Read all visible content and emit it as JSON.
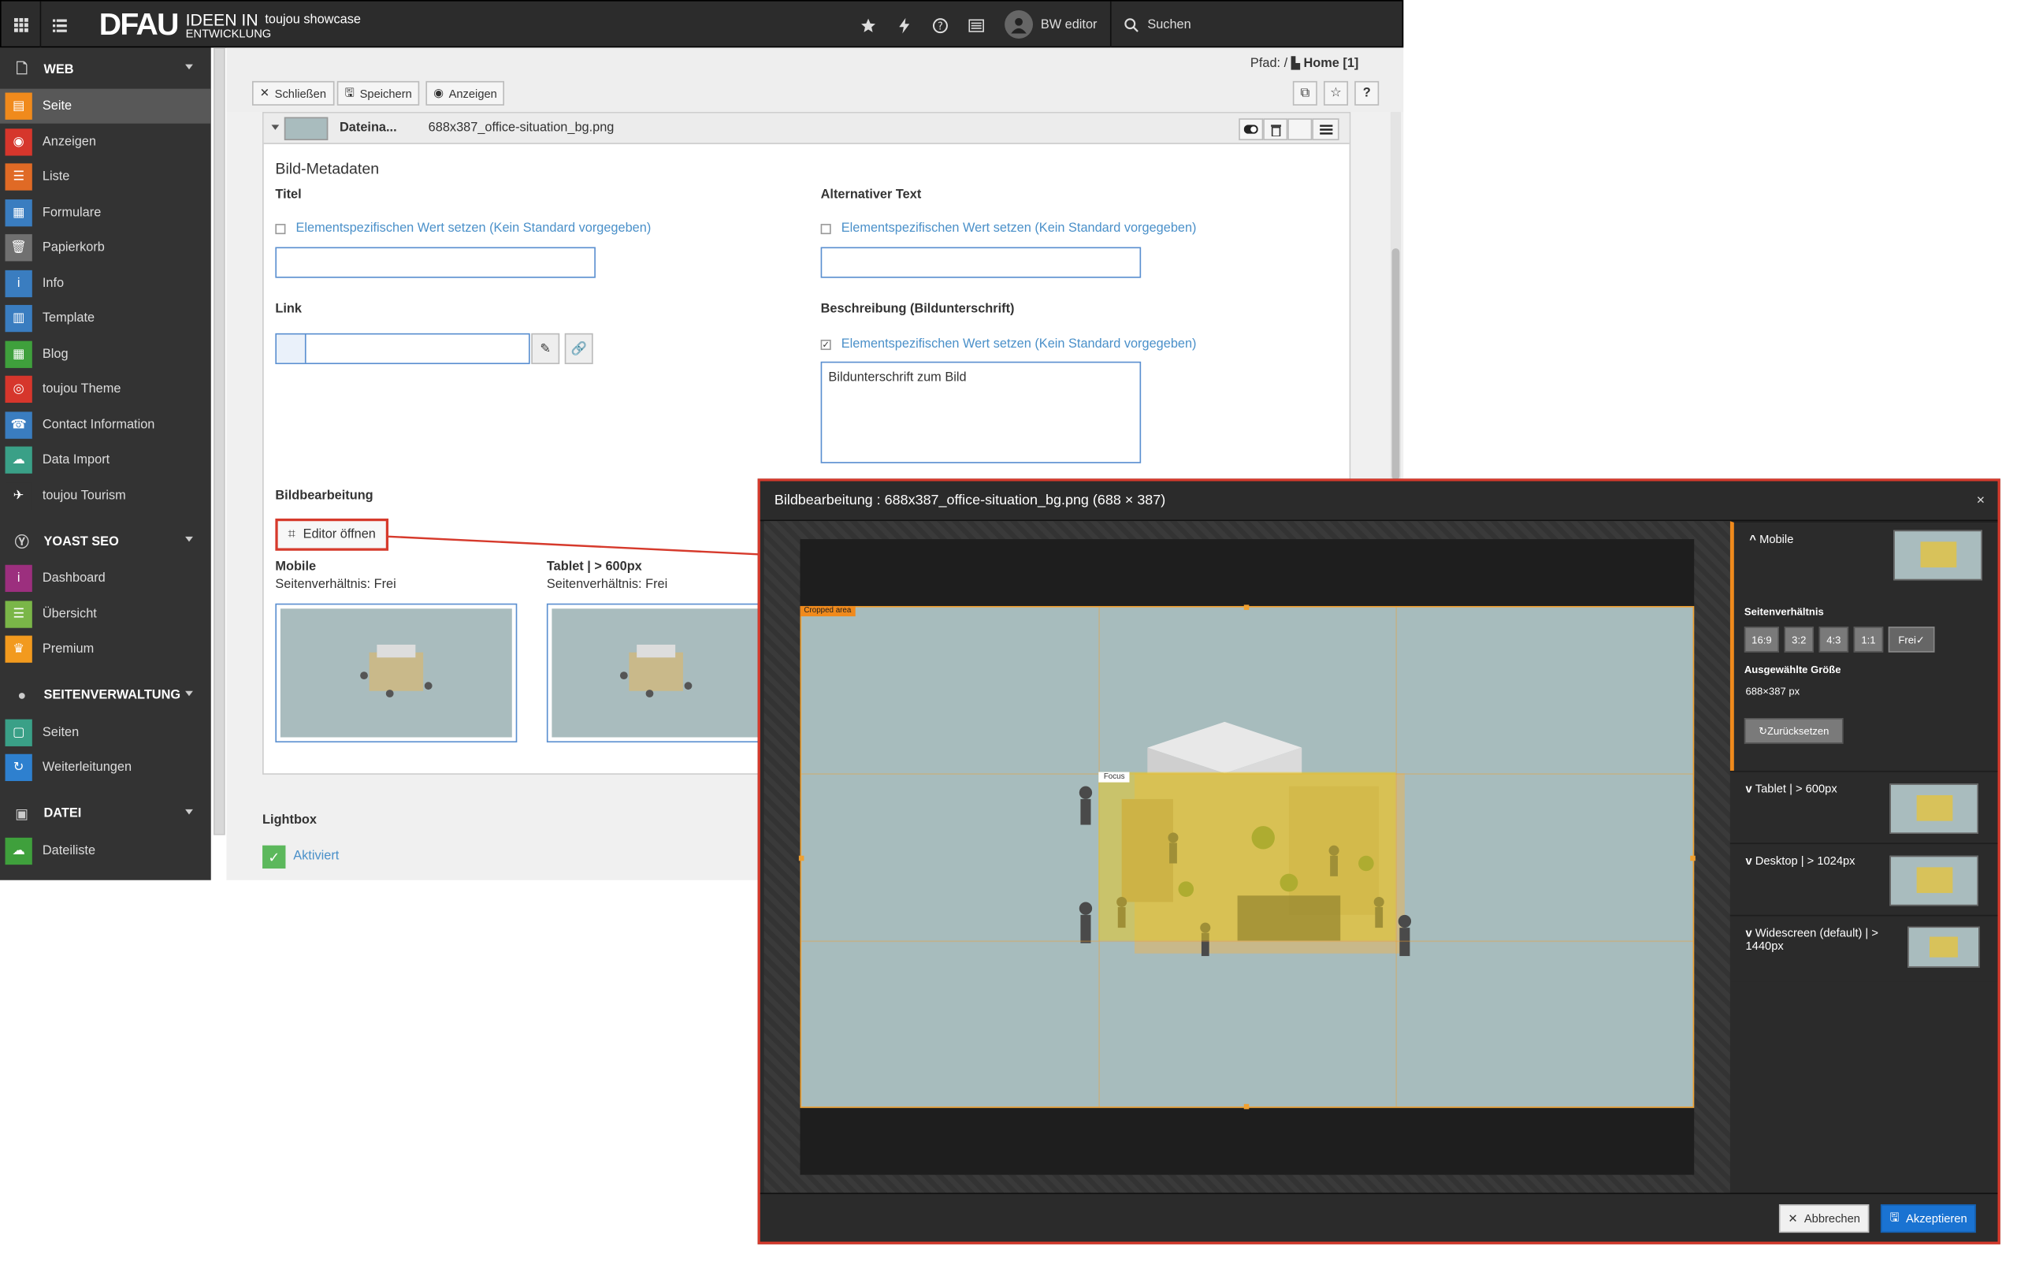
{
  "topbar": {
    "logo_text": "DFAU",
    "logo_sub_1": "IDEEN IN",
    "logo_sub_2": "ENTWICKLUNG",
    "site_name": "toujou showcase",
    "user_name": "BW editor",
    "search_label": "Suchen"
  },
  "sidebar": {
    "sections": [
      {
        "title": "WEB",
        "items": [
          "Seite",
          "Anzeigen",
          "Liste",
          "Formulare",
          "Papierkorb",
          "Info",
          "Template",
          "Blog",
          "toujou Theme",
          "Contact Information",
          "Data Import",
          "toujou Tourism"
        ]
      },
      {
        "title": "YOAST SEO",
        "items": [
          "Dashboard",
          "Übersicht",
          "Premium"
        ]
      },
      {
        "title": "SEITENVERWALTUNG",
        "items": [
          "Seiten",
          "Weiterleitungen"
        ]
      },
      {
        "title": "DATEI",
        "items": [
          "Dateiliste"
        ]
      }
    ],
    "item_colors": {
      "Seite": "#f08a1c",
      "Anzeigen": "#d6362c",
      "Liste": "#e06a25",
      "Formulare": "#3a7dc0",
      "Papierkorb": "#707070",
      "Info": "#3a7dc0",
      "Template": "#3a7dc0",
      "Blog": "#3fa03c",
      "toujou Theme": "#d6362c",
      "Contact Information": "#3a7dc0",
      "Data Import": "#3aa087",
      "toujou Tourism": "#333333",
      "Dashboard": "#9c2f7e",
      "Übersicht": "#7ab648",
      "Premium": "#f29a1e",
      "Seiten": "#3aa087",
      "Weiterleitungen": "#2e80cf",
      "Dateiliste": "#3fa03c"
    }
  },
  "docheader": {
    "close_label": "Schließen",
    "save_label": "Speichern",
    "view_label": "Anzeigen",
    "path_label": "Pfad: /",
    "path_page": "Home [1]",
    "help_label": "?"
  },
  "file_ref": {
    "header_label": "Dateina...",
    "filename": "688x387_office-situation_bg.png",
    "metadata_title": "Bild-Metadaten",
    "title_label": "Titel",
    "title_override": "Elementspezifischen Wert setzen (Kein Standard vorgegeben)",
    "alt_label": "Alternativer Text",
    "alt_override": "Elementspezifischen Wert setzen (Kein Standard vorgegeben)",
    "link_label": "Link",
    "desc_label": "Beschreibung (Bildunterschrift)",
    "desc_override": "Elementspezifischen Wert setzen (Kein Standard vorgegeben)",
    "desc_value": "Bildunterschrift zum Bild",
    "editing_label": "Bildbearbeitung",
    "editor_button": "Editor öffnen",
    "variants": [
      {
        "name": "Mobile",
        "ratio": "Seitenverhältnis: Frei"
      },
      {
        "name": "Tablet | > 600px",
        "ratio": "Seitenverhältnis: Frei"
      }
    ]
  },
  "lightbox": {
    "title": "Lightbox",
    "value": "Aktiviert"
  },
  "modal": {
    "title": "Bildbearbeitung : 688x387_office-situation_bg.png (688 × 387)",
    "close_label": "×",
    "cropped_label": "Cropped area",
    "focus_label": "Focus",
    "sections": [
      {
        "title": "Mobile",
        "expanded": true
      },
      {
        "title": "Tablet | > 600px",
        "expanded": false
      },
      {
        "title": "Desktop | > 1024px",
        "expanded": false
      },
      {
        "title": "Widescreen (default) | > 1440px",
        "expanded": false
      }
    ],
    "ratio_heading": "Seitenverhältnis",
    "ratios": [
      "16:9",
      "3:2",
      "4:3",
      "1:1",
      "Frei"
    ],
    "selected_ratio": "Frei",
    "size_heading": "Ausgewählte Größe",
    "size_value": "688×387 px",
    "reset_label": "Zurücksetzen",
    "cancel_label": "Abbrechen",
    "accept_label": "Akzeptieren"
  }
}
